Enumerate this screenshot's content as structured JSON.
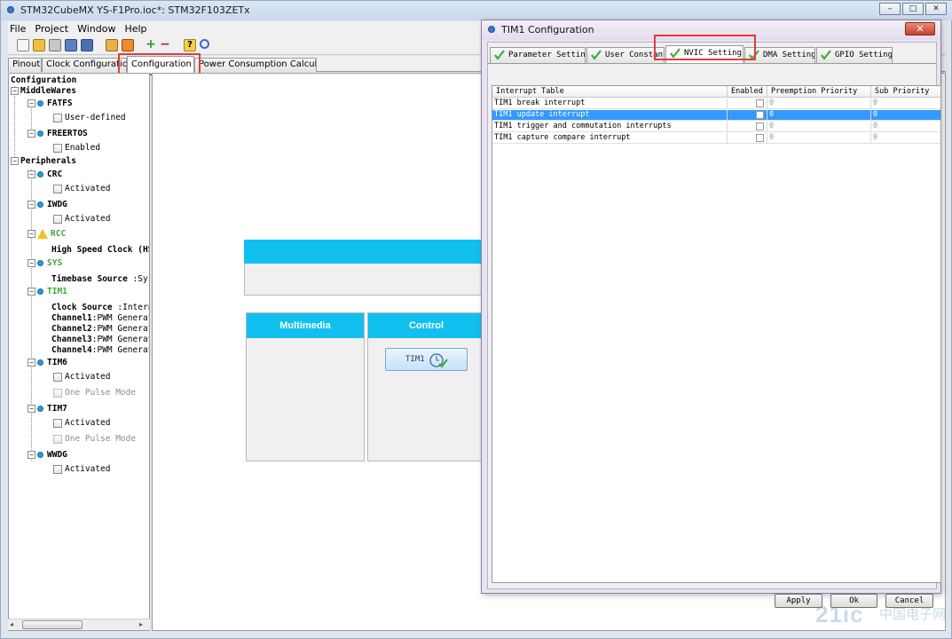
{
  "window": {
    "title": "STM32CubeMX YS-F1Pro.ioc*: STM32F103ZETx",
    "buttons": [
      "–",
      "□",
      "✕"
    ]
  },
  "menu": [
    "File",
    "Project",
    "Window",
    "Help"
  ],
  "tabs": [
    "Pinout",
    "Clock Configuration",
    "Configuration",
    "Power Consumption Calculator"
  ],
  "tree": {
    "root": "Configuration",
    "middlewares": "MiddleWares",
    "fatfs": "FATFS",
    "fatfs_opt": "User-defined",
    "freertos": "FREERTOS",
    "freertos_opt": "Enabled",
    "peripherals": "Peripherals",
    "crc": "CRC",
    "activated": "Activated",
    "iwdg": "IWDG",
    "rcc": "RCC",
    "rcc_hse": "High Speed Clock (HS",
    "sys": "SYS",
    "sys_timebase_label": "Timebase Source",
    "sys_timebase_val": ":SysTi",
    "tim1": "TIM1",
    "tim1_clock_label": "Clock Source",
    "tim1_clock_val": ":Interna",
    "ch1_label": "Channel1",
    "ch2_label": "Channel2",
    "ch3_label": "Channel3",
    "ch4_label": "Channel4",
    "ch_val": ":PWM Generati",
    "tim6": "TIM6",
    "one_pulse": "One Pulse Mode",
    "tim7": "TIM7",
    "wwdg": "WWDG"
  },
  "canvas": {
    "multimedia": "Multimedia",
    "control": "Control",
    "tim1_button": "TIM1"
  },
  "dialog": {
    "title": "TIM1 Configuration",
    "close": "✕",
    "tabs": [
      "Parameter Settings",
      "User Constants",
      "NVIC Settings",
      "DMA Settings",
      "GPIO Settings"
    ],
    "columns": [
      "Interrupt Table",
      "Enabled",
      "Preemption Priority",
      "Sub Priority"
    ],
    "rows": [
      {
        "name": "TIM1 break interrupt",
        "pre": "0",
        "sub": "0",
        "selected": false
      },
      {
        "name": "TIM1 update interrupt",
        "pre": "0",
        "sub": "0",
        "selected": true
      },
      {
        "name": "TIM1 trigger and commutation interrupts",
        "pre": "0",
        "sub": "0",
        "selected": false
      },
      {
        "name": "TIM1 capture compare interrupt",
        "pre": "0",
        "sub": "0",
        "selected": false
      }
    ],
    "buttons": {
      "apply": "Apply",
      "ok": "Ok",
      "cancel": "Cancel"
    }
  },
  "watermark": {
    "main": "21ic",
    "sub": "中国电子网"
  },
  "colors": {
    "accent": "#12c0ef",
    "selection": "#3399ff",
    "highlight": "#e23c3c",
    "ok_green": "#41a83a"
  }
}
